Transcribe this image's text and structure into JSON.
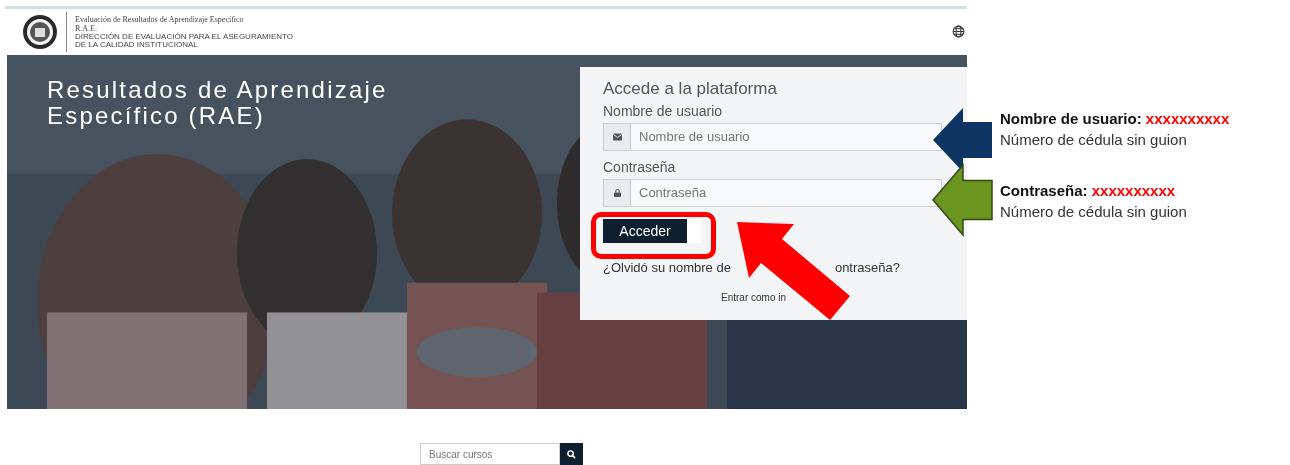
{
  "header": {
    "title": "Evaluación de Resultados de Aprendizaje Específico",
    "subtitle": "R.A.E.",
    "caption_lines": [
      "DIRECCIÓN DE EVALUACIÓN PARA EL ASEGURAMIENTO",
      "DE LA CALIDAD INSTITUCIONAL"
    ]
  },
  "hero": {
    "title_lines": [
      "Resultados de Aprendizaje",
      "Específico (RAE)"
    ]
  },
  "login": {
    "heading": "Accede a la plataforma",
    "fields": [
      {
        "kind": "user",
        "label": "Nombre de usuario",
        "placeholder": "Nombre de usuario"
      },
      {
        "kind": "password",
        "label": "Contraseña",
        "placeholder": "Contraseña"
      }
    ],
    "button": "Acceder",
    "forgot_parts": [
      "¿Olvidó su nombre de",
      "ontraseña?"
    ],
    "guest": "Entrar como in"
  },
  "annotations": [
    {
      "label": "Nombre de usuario:",
      "value": "xxxxxxxxxx",
      "note": "Número de cédula sin guion",
      "color": "#0d3462"
    },
    {
      "label": "Contraseña:",
      "value": "xxxxxxxxxx",
      "note": "Número de cédula sin guion",
      "color": "#6a961f"
    }
  ],
  "search": {
    "placeholder": "Buscar cursos"
  }
}
